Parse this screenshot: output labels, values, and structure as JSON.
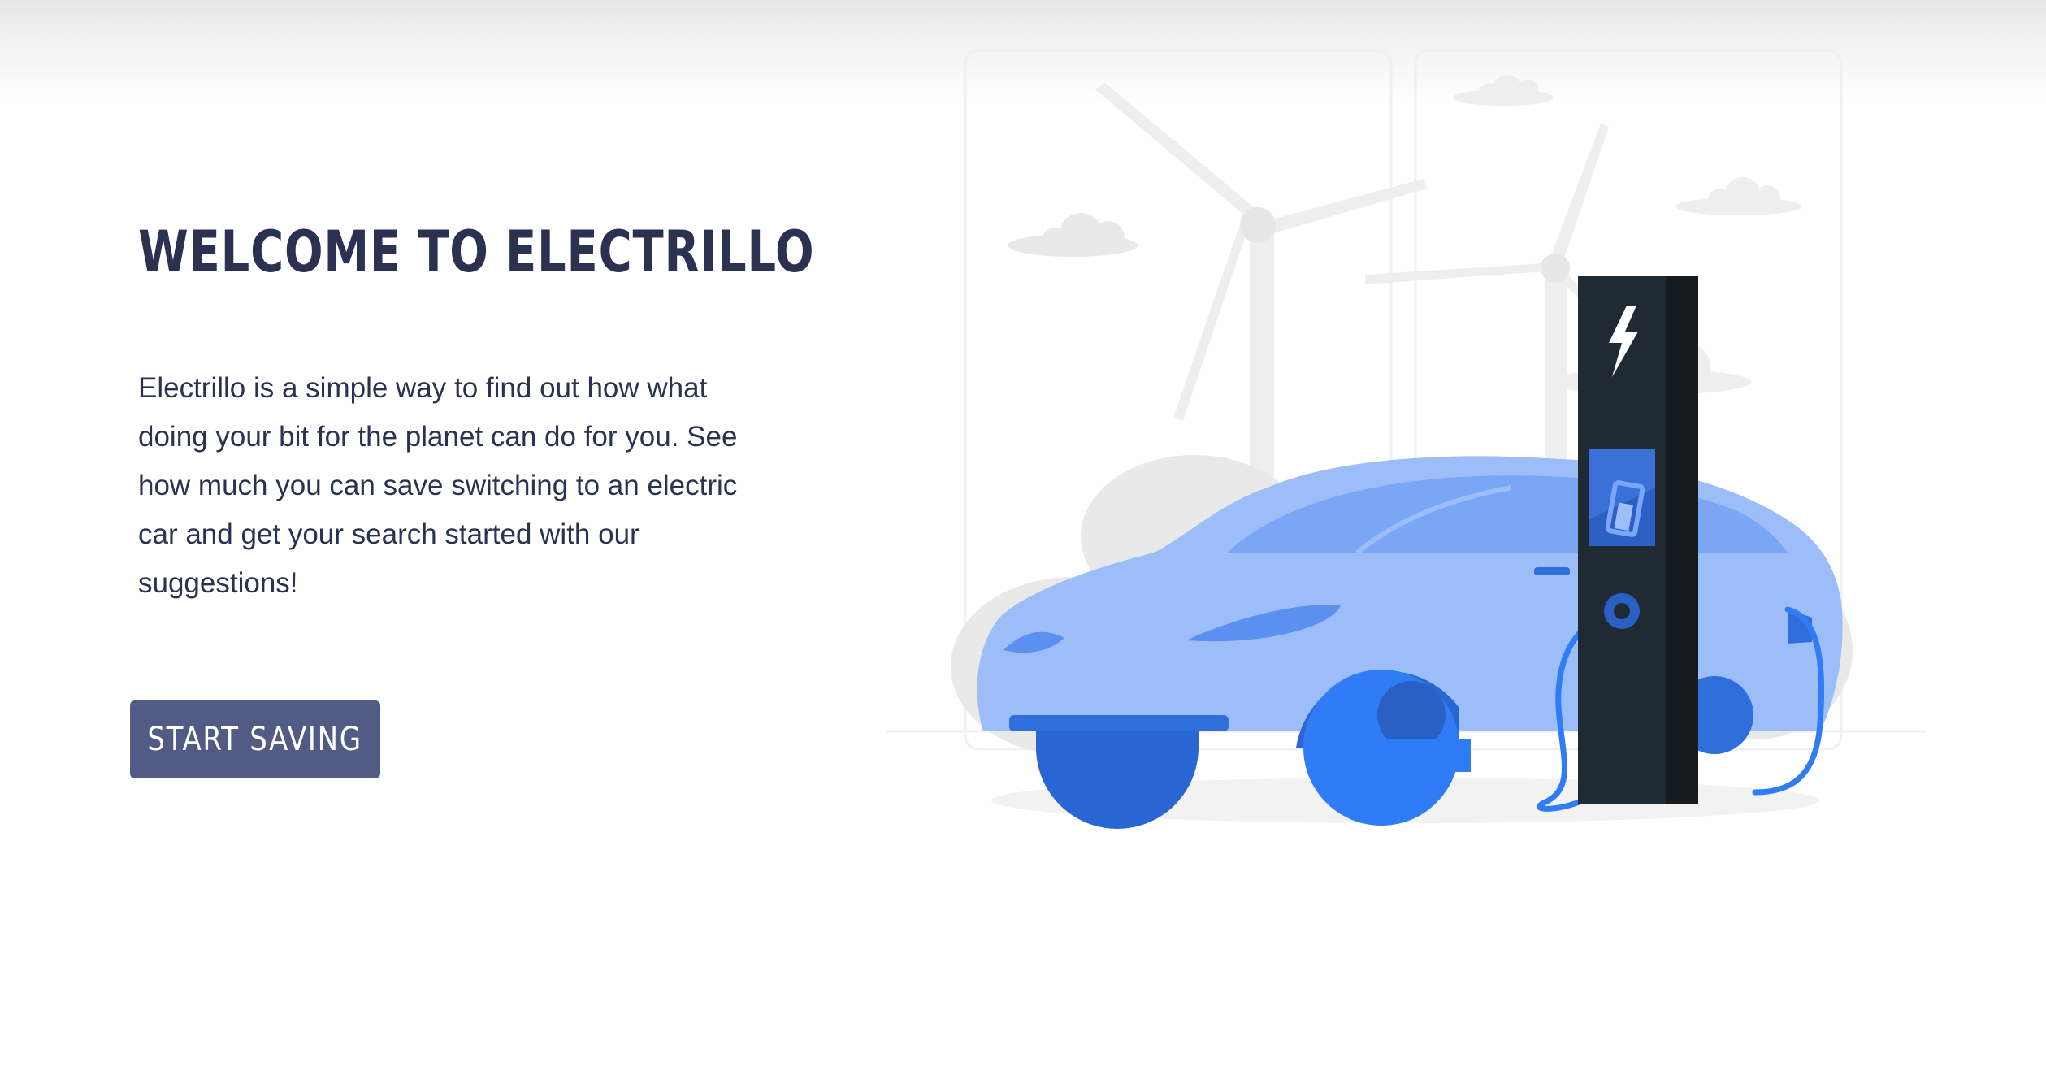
{
  "hero": {
    "title": "WELCOME TO ELECTRILLO",
    "description": "Electrillo is a simple way to find out how what doing your bit for the planet can do for you. See how much you can save switching to an electric car and get your search started with our suggestions!",
    "cta_label": "START SAVING"
  },
  "colors": {
    "heading": "#2b3150",
    "button": "#525b83",
    "car_light": "#9dbdf9",
    "car_mid": "#7aa6f5",
    "car_dark": "#2f6fdb",
    "charger": "#1f2a33"
  },
  "illustration": {
    "description_icon": "electric-car-charging-illustration",
    "elements": [
      "wind-turbine-icon",
      "cloud-icon",
      "electric-car-icon",
      "charging-station-icon",
      "lightning-bolt-icon",
      "battery-icon",
      "charging-cable-icon"
    ]
  }
}
